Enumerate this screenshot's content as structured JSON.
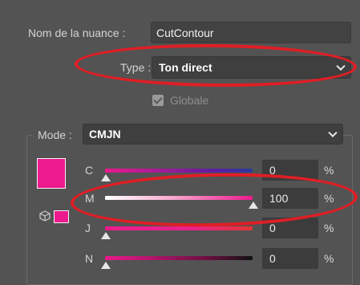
{
  "swatch_name": {
    "label": "Nom de la nuance :",
    "value": "CutContour"
  },
  "type": {
    "label": "Type :",
    "value": "Ton direct"
  },
  "global_checkbox": {
    "label": "Globale",
    "checked": true
  },
  "mode": {
    "label": "Mode :",
    "value": "CMJN"
  },
  "channels": [
    {
      "letter": "C",
      "value": "0",
      "unit": "%"
    },
    {
      "letter": "M",
      "value": "100",
      "unit": "%"
    },
    {
      "letter": "J",
      "value": "0",
      "unit": "%"
    },
    {
      "letter": "N",
      "value": "0",
      "unit": "%"
    }
  ],
  "colors": {
    "swatch": "#ec1a8c",
    "annotation": "#e01e25"
  },
  "icons": [
    "cube-icon",
    "chevron-down-icon",
    "checkbox-icon"
  ]
}
